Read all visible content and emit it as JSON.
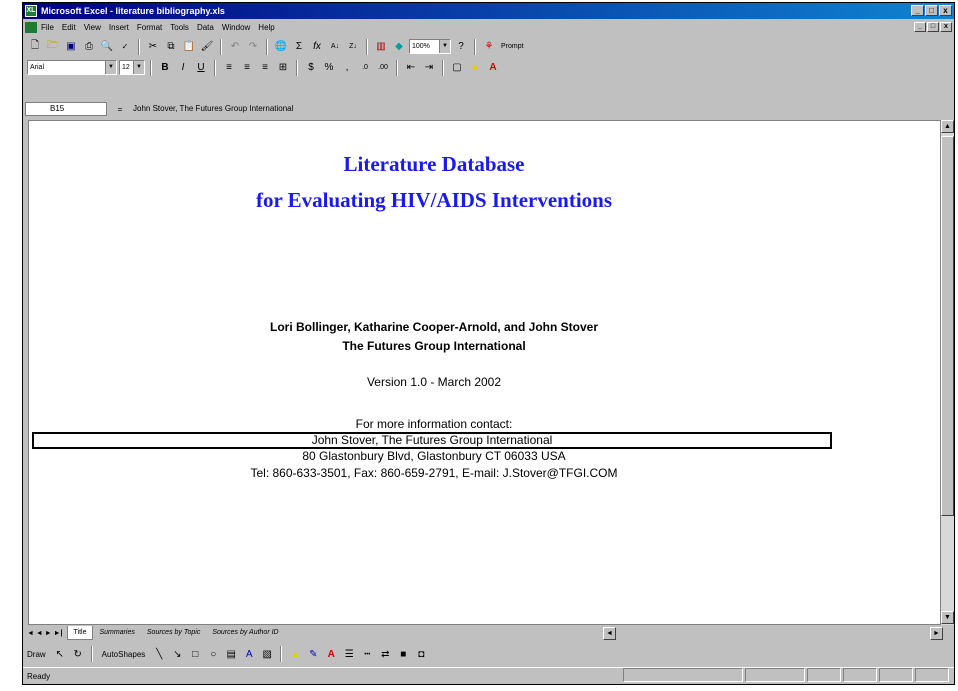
{
  "window": {
    "title": "Microsoft Excel - literature bibliography.xls",
    "app_icon": "XL",
    "controls": [
      "_",
      "□",
      "x"
    ],
    "doc_controls": [
      "_",
      "□",
      "x"
    ]
  },
  "menu": {
    "items": [
      "File",
      "Edit",
      "View",
      "Insert",
      "Format",
      "Tools",
      "Data",
      "Window",
      "Help"
    ]
  },
  "toolbar": {
    "zoom": "100%",
    "prompt_label": "Prompt",
    "font_name": "Arial",
    "font_size": "12"
  },
  "formula_bar": {
    "cell_ref": "B15",
    "equals": "=",
    "content": "John Stover, The Futures Group International"
  },
  "document": {
    "title_line1": "Literature Database",
    "title_line2": "for Evaluating HIV/AIDS  Interventions",
    "authors": "Lori Bollinger, Katharine Cooper-Arnold, and John Stover",
    "org": "The Futures Group International",
    "version": "Version 1.0 - March 2002",
    "contact_heading": "For more information contact:",
    "contact_name": "John Stover, The Futures Group International",
    "address": "80 Glastonbury Blvd, Glastonbury CT 06033  USA",
    "phone": "Tel: 860-633-3501, Fax: 860-659-2791, E-mail: J.Stover@TFGI.COM"
  },
  "sheet_tabs": {
    "nav": "◄ ◄ ► ►|",
    "tabs": [
      "Title",
      "Summaries",
      "Sources by Topic",
      "Sources by Author ID"
    ]
  },
  "drawing": {
    "draw_label": "Draw",
    "autoshapes_label": "AutoShapes"
  },
  "status": {
    "text": "Ready"
  }
}
